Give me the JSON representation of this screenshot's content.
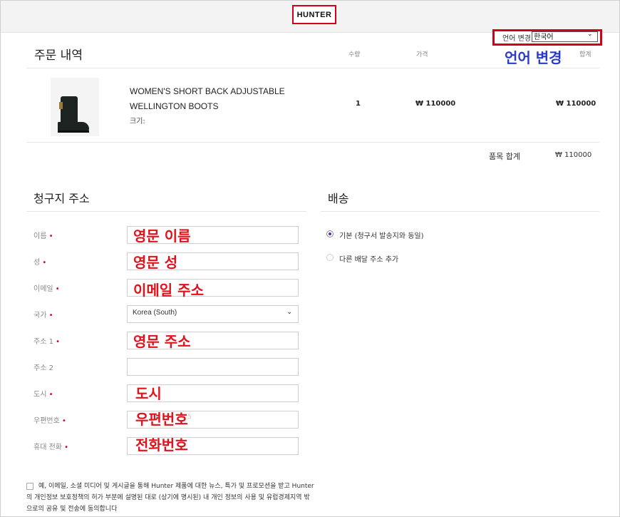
{
  "header": {
    "logo_text": "HUNTER"
  },
  "language": {
    "label": "언어 변경",
    "selected": "한국어",
    "annotation": "언어 변경"
  },
  "order": {
    "title": "주문 내역",
    "columns": {
      "qty": "수량",
      "price": "가격",
      "total": "합계"
    },
    "item": {
      "name": "WOMEN'S SHORT BACK ADJUSTABLE WELLINGTON BOOTS",
      "size_label": "크기:",
      "qty": "1",
      "price": "₩ 110000",
      "total": "₩ 110000"
    },
    "subtotal_label": "품목 합계",
    "subtotal_value": "₩ 110000"
  },
  "billing": {
    "title": "청구지 주소",
    "fields": {
      "first_name": {
        "label": "이름",
        "req": "•",
        "annotation": "영문 이름"
      },
      "last_name": {
        "label": "성",
        "req": "•",
        "annotation": "영문 성"
      },
      "email": {
        "label": "이메일",
        "req": "•",
        "annotation": "이메일 주소"
      },
      "country": {
        "label": "국가",
        "req": "•",
        "value": "Korea (South)"
      },
      "address1": {
        "label": "주소 1",
        "req": "•",
        "annotation": "영문 주소"
      },
      "address2": {
        "label": "주소 2"
      },
      "city": {
        "label": "도시",
        "req": "•",
        "annotation": "도시"
      },
      "postcode": {
        "label": "우편번호",
        "req": "•",
        "annotation": "우편번호",
        "ghost": "5"
      },
      "phone": {
        "label": "휴대 전화",
        "req": "•",
        "annotation": "전화번호"
      }
    }
  },
  "shipping": {
    "title": "배송",
    "options": [
      {
        "label": "기본 (청구서 발송지와 동일)",
        "selected": true
      },
      {
        "label": "다른 배달 주소 추가",
        "selected": false
      }
    ]
  },
  "consent": {
    "text": "예, 이메일, 소셜 미디어 및 게시글을 통해 Hunter 제품에 대한 뉴스, 특가 및 프로모션을 받고 Hunter의 개인정보 보호정책의 허가 부분에 설명된 대로 (상기에 명시된) 내 개인 정보의 사용 및 유럽경제지역 밖으로의 공유 및 전송에 동의합니다"
  },
  "colors": {
    "annotation_red": "#e0121b",
    "annotation_blue": "#2b3bc9",
    "radio_selected": "#5b2bb5"
  }
}
